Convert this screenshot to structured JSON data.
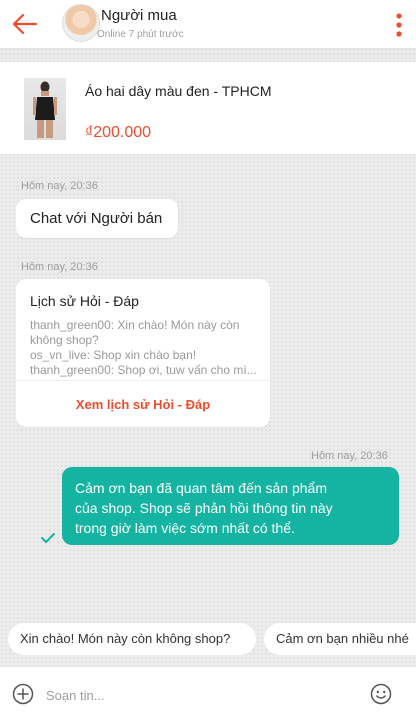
{
  "header": {
    "name": "Người mua",
    "status": "Online 7 phút trước",
    "back_icon": "arrow-left-icon",
    "menu_icon": "more-vertical-icon",
    "accent_color": "#ee4d2d"
  },
  "product": {
    "title": "Áo hai dây màu đen - TPHCM",
    "price": "₫200.000"
  },
  "messages": [
    {
      "time": "Hôm nay, 20:36",
      "text": "Chat với Người bán"
    },
    {
      "time": "Hôm nay, 20:36",
      "title": "Lịch sử Hỏi - Đáp",
      "lines": [
        "thanh_green00: Xin chào! Món này còn",
        "không shop?",
        "os_vn_live: Shop xin chào bạn!",
        "thanh_green00: Shop ơi, tuw vấn cho mì..."
      ],
      "link": "Xem lịch sử Hỏi - Đáp"
    },
    {
      "time": "Hôm nay, 20:36",
      "lines": [
        "Cảm ơn bạn đã quan tâm đến sản phẩm",
        "của shop. Shop sẽ phản hồi thông tin này",
        "trong giờ làm việc sớm nhất có thể."
      ],
      "status_icon": "check-icon",
      "bubble_color": "#15b3a1"
    }
  ],
  "quick_replies": [
    "Xin chào! Món này còn không shop?",
    "Cảm ơn bạn nhiều nhé"
  ],
  "composer": {
    "placeholder": "Soạn tin...",
    "add_icon": "add-circle-icon",
    "emoji_icon": "emoji-icon"
  }
}
